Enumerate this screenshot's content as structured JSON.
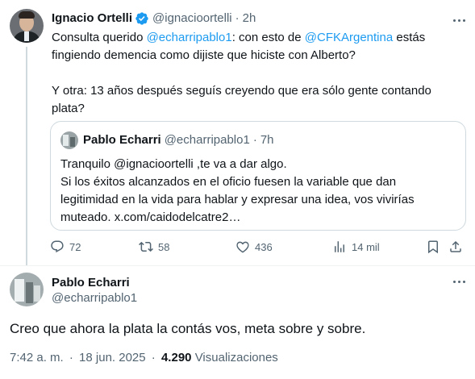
{
  "reply_tweet": {
    "author_name": "Ignacio Ortelli",
    "author_handle": "@ignacioortelli",
    "separator": "·",
    "time": "2h",
    "text_intro": "Consulta querido ",
    "mention1": "@echarripablo1",
    "text_mid": ": con esto de ",
    "mention2": "@CFKArgentina",
    "text_end": " estás fingiendo demencia como dijiste que hiciste con Alberto?",
    "paragraph2": "Y otra: 13 años después seguís creyendo que era sólo gente contando plata?",
    "quote": {
      "author_name": "Pablo Echarri",
      "author_handle": "@echarripablo1",
      "separator": "·",
      "time": "7h",
      "line1": "Tranquilo @ignacioortelli ,te va a dar algo.",
      "line2": "Si los éxitos alcanzados en el oficio fuesen la variable que dan legitimidad en la vida para hablar y expresar una idea, vos vivirías muteado. x.com/caidodelcatre2…"
    },
    "actions": {
      "replies": "72",
      "retweets": "58",
      "likes": "436",
      "views": "14 mil"
    }
  },
  "main_tweet": {
    "author_name": "Pablo Echarri",
    "author_handle": "@echarripablo1",
    "text": "Creo que ahora la plata la contás vos, meta sobre y sobre.",
    "time": "7:42 a. m.",
    "dot": "·",
    "date": "18 jun. 2025",
    "dot2": "·",
    "views_count": "4.290",
    "views_label": "Visualizaciones"
  },
  "colors": {
    "accent": "#1d9bf0",
    "muted": "#536471",
    "text": "#0f1419",
    "border": "#cfd9de"
  },
  "icons": [
    "verified-badge-icon",
    "more-icon",
    "reply-icon",
    "retweet-icon",
    "like-icon",
    "views-icon",
    "bookmark-icon",
    "share-icon"
  ]
}
